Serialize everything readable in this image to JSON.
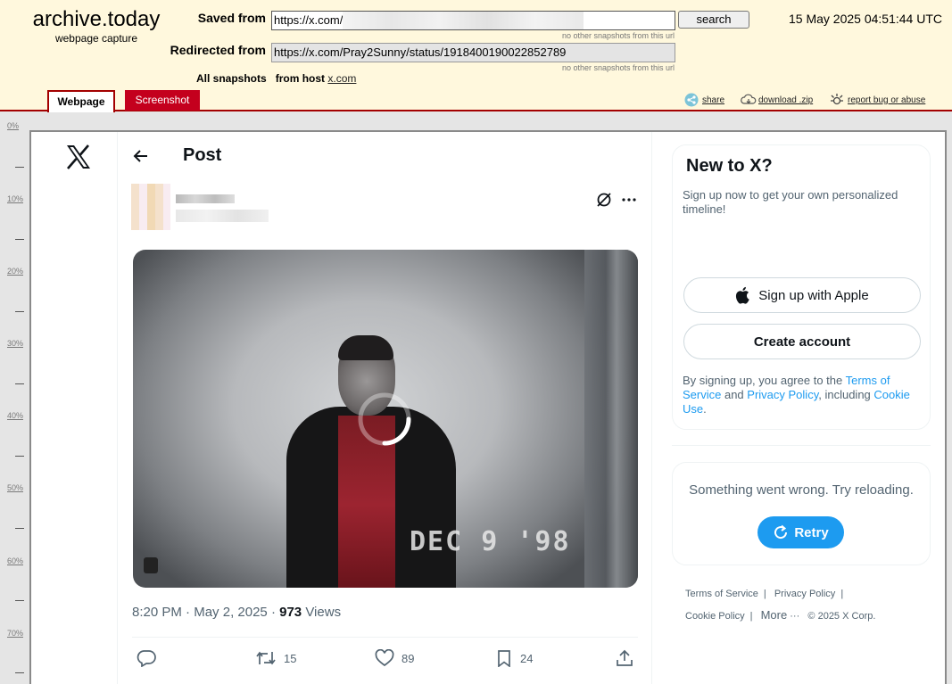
{
  "archive": {
    "brand_title": "archive.today",
    "brand_subtitle": "webpage capture",
    "saved_from_label": "Saved from",
    "saved_from_url": "https://x.com/",
    "no_other_note_1": "no other snapshots from this url",
    "search_label": "search",
    "timestamp": "15 May 2025 04:51:44 UTC",
    "redirected_from_label": "Redirected from",
    "redirected_url": "https://x.com/Pray2Sunny/status/1918400190022852789",
    "no_other_note_2": "no other snapshots from this url",
    "all_snapshots_label": "All snapshots",
    "from_host_label": "from host",
    "host": "x.com",
    "tabs": [
      "Webpage",
      "Screenshot"
    ],
    "actions": [
      "share",
      "download .zip",
      "report bug or abuse"
    ],
    "accent": "#a30000"
  },
  "ruler": {
    "labels": [
      "0%",
      "10%",
      "20%",
      "30%",
      "40%",
      "50%",
      "60%",
      "70%"
    ]
  },
  "post": {
    "header_title": "Post",
    "video_stamp": "DEC  9 '98",
    "time": "8:20 PM",
    "date": "May 2, 2025",
    "views_count": "973",
    "views_label": "Views",
    "retweets": "15",
    "likes": "89",
    "bookmarks": "24"
  },
  "sidebar": {
    "new_title": "New to X?",
    "new_subtitle": "Sign up now to get your own personalized timeline!",
    "apple_button": "Sign up with Apple",
    "create_button": "Create account",
    "terms_prefix": "By signing up, you agree to the ",
    "terms_link": "Terms of Service",
    "terms_and": " and ",
    "privacy_link": "Privacy Policy",
    "terms_including": ", including ",
    "cookie_link": "Cookie Use",
    "terms_end": ".",
    "error_text": "Something went wrong. Try reloading.",
    "retry_label": "Retry",
    "footer": {
      "terms": "Terms of Service",
      "privacy": "Privacy Policy",
      "cookie": "Cookie Policy",
      "more": "More",
      "copyright": "© 2025 X Corp."
    },
    "brand_color": "#1d9bf0"
  }
}
